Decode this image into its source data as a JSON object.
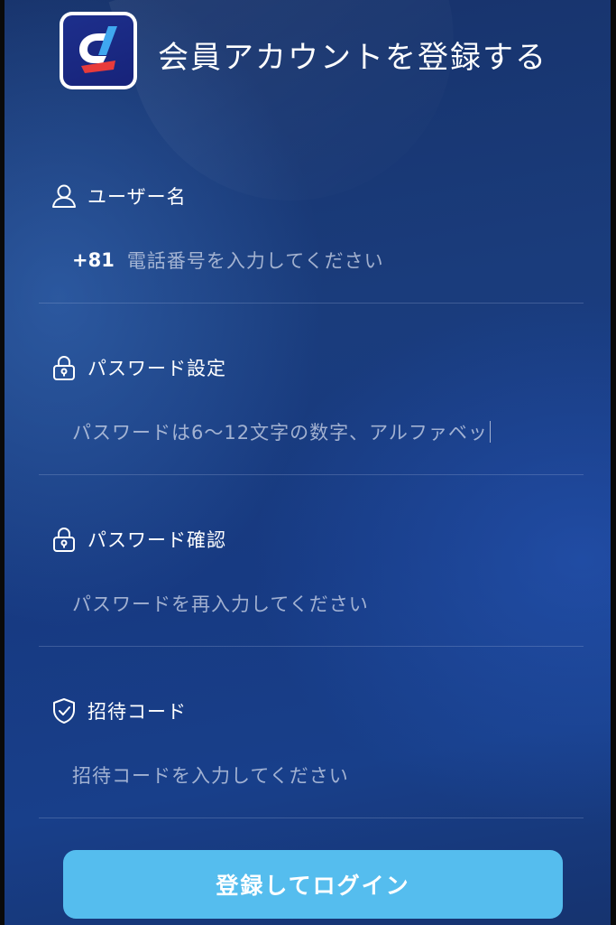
{
  "header": {
    "title": "会員アカウントを登録する",
    "logo_icon": "app-logo-icon"
  },
  "form": {
    "username": {
      "label": "ユーザー名",
      "icon": "user-icon",
      "prefix": "+81",
      "placeholder": "電話番号を入力してください"
    },
    "password": {
      "label": "パスワード設定",
      "icon": "lock-icon",
      "placeholder": "パスワードは6～12文字の数字、アルファベッ"
    },
    "password_confirm": {
      "label": "パスワード確認",
      "icon": "lock-icon",
      "placeholder": "パスワードを再入力してください"
    },
    "invite_code": {
      "label": "招待コード",
      "icon": "shield-check-icon",
      "placeholder": "招待コードを入力してください"
    },
    "submit_label": "登録してログイン"
  },
  "colors": {
    "background": "#1a3c7c",
    "button": "#55bdee",
    "text": "#ffffff"
  }
}
